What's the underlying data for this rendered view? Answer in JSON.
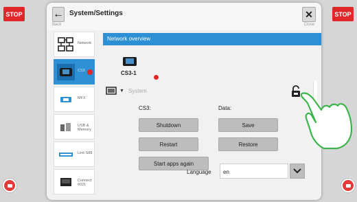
{
  "stop": {
    "left_label": "STOP",
    "right_label": "STOP"
  },
  "header": {
    "back_label": "Back",
    "title": "System/Settings",
    "close_symbol": "✕",
    "close_label": "Close"
  },
  "sidebar": {
    "items": [
      {
        "label": "Network",
        "icon": "network-icon",
        "active": false
      },
      {
        "label": "CS3",
        "icon": "cs3-device-icon",
        "active": true,
        "alert": true
      },
      {
        "label": "MFX",
        "icon": "mfx-icon",
        "active": false
      },
      {
        "label": "USB & Memory",
        "icon": "usb-memory-icon",
        "active": false
      },
      {
        "label": "Link S88",
        "icon": "link-s88-icon",
        "active": false
      },
      {
        "label": "Connect 6021",
        "icon": "connect-6021-icon",
        "active": false
      }
    ]
  },
  "panel": {
    "section_title": "Network overview",
    "device_name": "CS3-1",
    "system_label": "System",
    "cs3_column": "CS3:",
    "data_column": "Data:",
    "buttons": {
      "shutdown": "Shutdown",
      "restart": "Restart",
      "start_apps": "Start apps again",
      "save": "Save",
      "restore": "Restore"
    },
    "language_label": "Language",
    "language_value": "en"
  },
  "colors": {
    "accent": "#2d8fd4",
    "stop_red": "#e0282a",
    "status_red": "#e02828",
    "hand_green": "#3bb54a"
  }
}
